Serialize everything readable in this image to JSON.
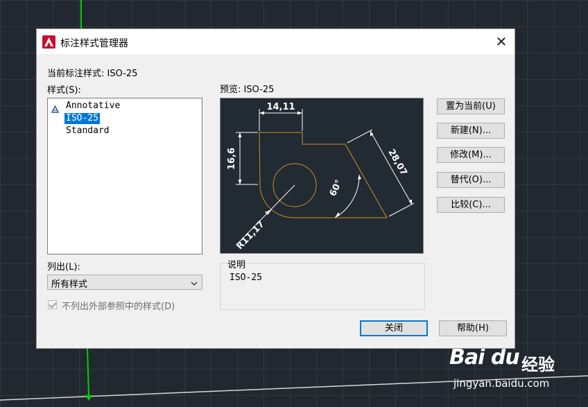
{
  "dialog": {
    "title": "标注样式管理器",
    "current_style_label": "当前标注样式: ISO-25",
    "styles_label": "样式(S):",
    "styles": [
      {
        "name": "Annotative",
        "annotative": true
      },
      {
        "name": "ISO-25",
        "selected": true
      },
      {
        "name": "Standard"
      }
    ],
    "list_label": "列出(L):",
    "list_value": "所有样式",
    "exclude_xref_label": "不列出外部参照中的样式(D)",
    "preview_label": "预览: ISO-25",
    "description_legend": "说明",
    "description_text": "ISO-25",
    "buttons": {
      "set_current": "置为当前(U)",
      "new": "新建(N)...",
      "modify": "修改(M)...",
      "override": "替代(O)...",
      "compare": "比较(C)...",
      "close": "关闭",
      "help": "帮助(H)"
    }
  },
  "preview_dims": {
    "width": "14,11",
    "height": "16,6",
    "slant": "28,07",
    "angle": "60°",
    "radius": "R11,17"
  },
  "watermark": {
    "logo": "Bai  du",
    "cn": "经验",
    "url": "jingyan.baidu.com"
  },
  "colors": {
    "cad_background": "#212830",
    "shape_stroke": "#c8951e",
    "accent": "#0078d7",
    "cad_line": "#00d000"
  },
  "icons": [
    "autocad-app-icon",
    "close-icon",
    "annotative-icon",
    "chevron-down-icon",
    "checkmark-icon"
  ]
}
